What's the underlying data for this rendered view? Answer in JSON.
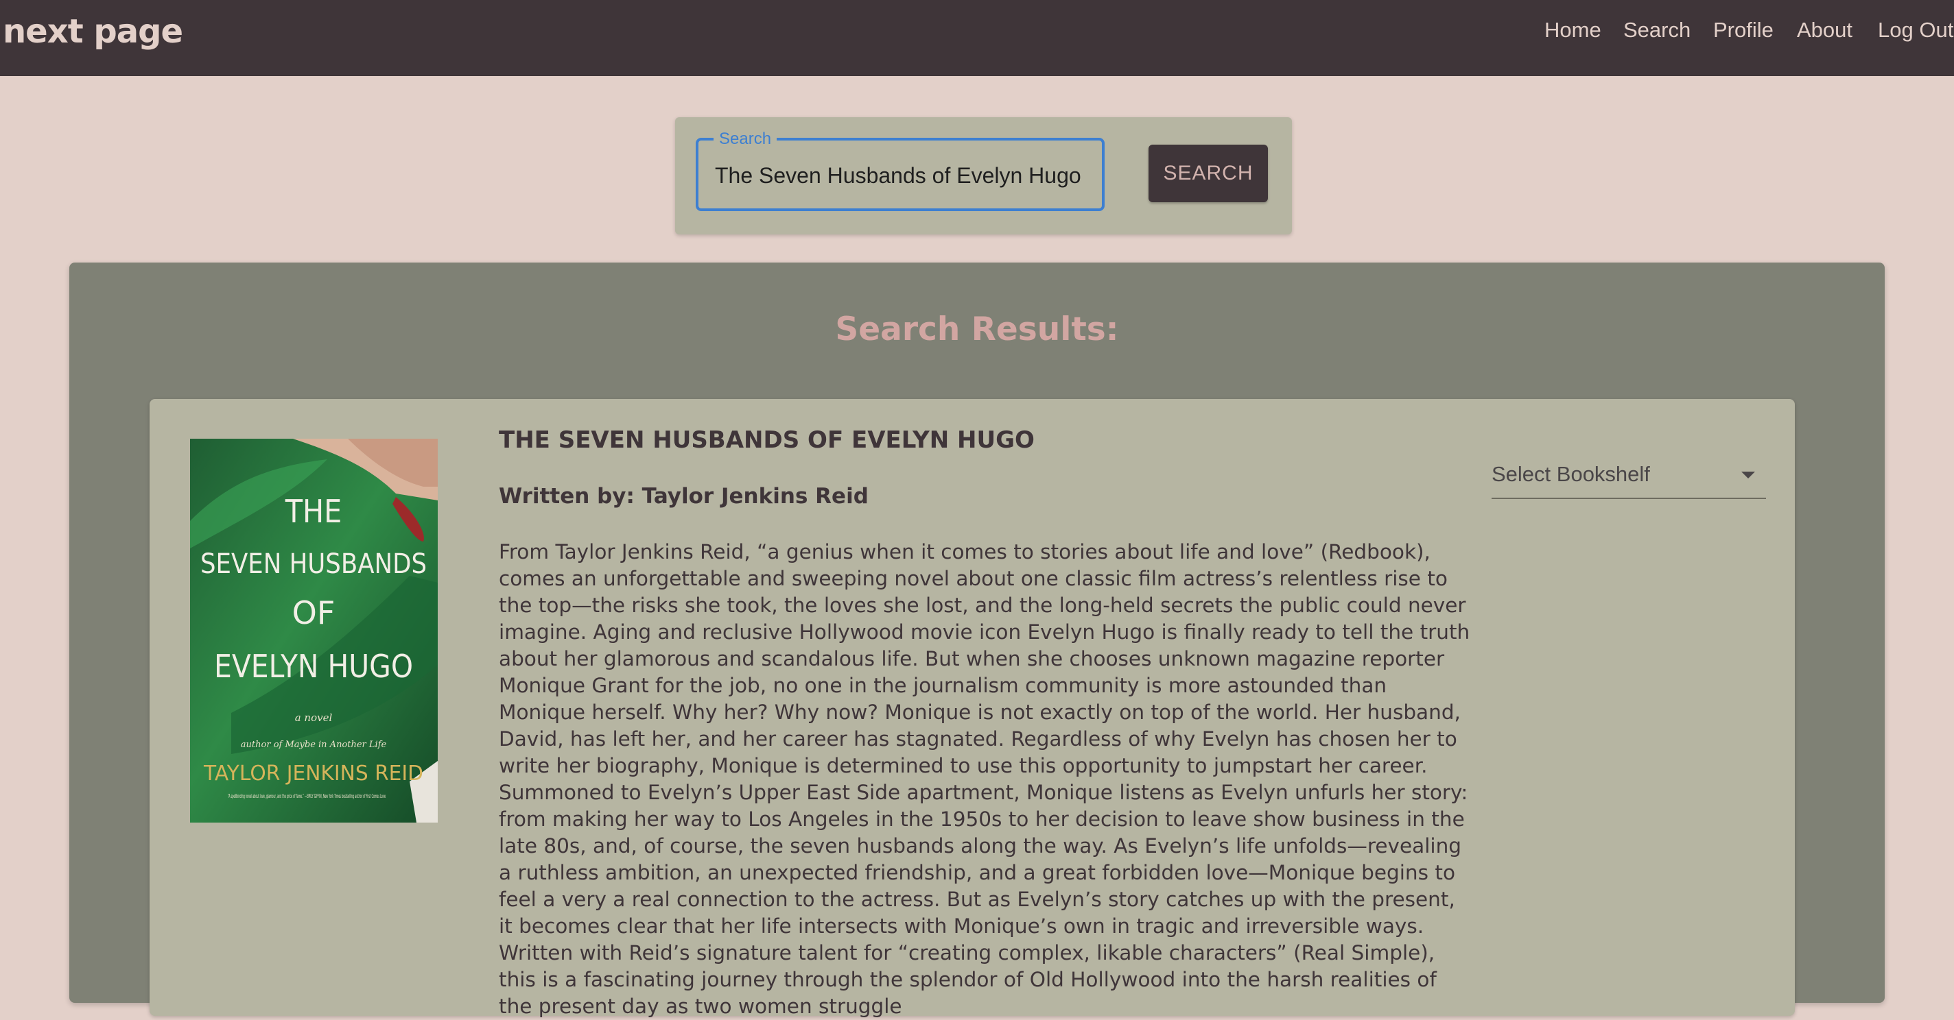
{
  "header": {
    "brand": "next page",
    "nav": {
      "home": "Home",
      "search": "Search",
      "profile": "Profile",
      "about": "About",
      "logout": "Log Out"
    }
  },
  "search": {
    "legend": "Search",
    "value": "The Seven Husbands of Evelyn Hugo",
    "button_label": "SEARCH"
  },
  "results": {
    "title": "Search Results:",
    "items": [
      {
        "title": "THE SEVEN HUSBANDS OF EVELYN HUGO",
        "author_line": "Written by: Taylor Jenkins Reid",
        "description": "From Taylor Jenkins Reid, “a genius when it comes to stories about life and love” (Redbook), comes an unforgettable and sweeping novel about one classic film actress’s relentless rise to the top—the risks she took, the loves she lost, and the long-held secrets the public could never imagine. Aging and reclusive Hollywood movie icon Evelyn Hugo is finally ready to tell the truth about her glamorous and scandalous life. But when she chooses unknown magazine reporter Monique Grant for the job, no one in the journalism community is more astounded than Monique herself. Why her? Why now? Monique is not exactly on top of the world. Her husband, David, has left her, and her career has stagnated. Regardless of why Evelyn has chosen her to write her biography, Monique is determined to use this opportunity to jumpstart her career. Summoned to Evelyn’s Upper East Side apartment, Monique listens as Evelyn unfurls her story: from making her way to Los Angeles in the 1950s to her decision to leave show business in the late 80s, and, of course, the seven husbands along the way. As Evelyn’s life unfolds—revealing a ruthless ambition, an unexpected friendship, and a great forbidden love—Monique begins to feel a very a real connection to the actress. But as Evelyn’s story catches up with the present, it becomes clear that her life intersects with Monique’s own in tragic and irreversible ways. Written with Reid’s signature talent for “creating complex, likable characters” (Real Simple), this is a fascinating journey through the splendor of Old Hollywood into the harsh realities of the present day as two women struggle",
        "bookshelf_placeholder": "Select Bookshelf",
        "cover": {
          "line1": "THE",
          "line2": "SEVEN HUSBANDS",
          "line3": "OF",
          "line4": "EVELYN HUGO",
          "tagline": "a novel",
          "byline": "author of Maybe in Another Life",
          "author": "TAYLOR JENKINS REID",
          "blurb": "“A spellbinding novel about love, glamour, and the price of fame.” —EMILY GIFFIN, New York Times bestselling author of First Comes Love"
        }
      }
    ]
  },
  "colors": {
    "header_bg": "#3f3539",
    "page_bg": "#e3d0c9",
    "panel_bg": "#b6b5a2",
    "results_bg": "#7f8175",
    "accent_blue": "#3d7fd1",
    "title_pink": "#d2a6a2"
  }
}
